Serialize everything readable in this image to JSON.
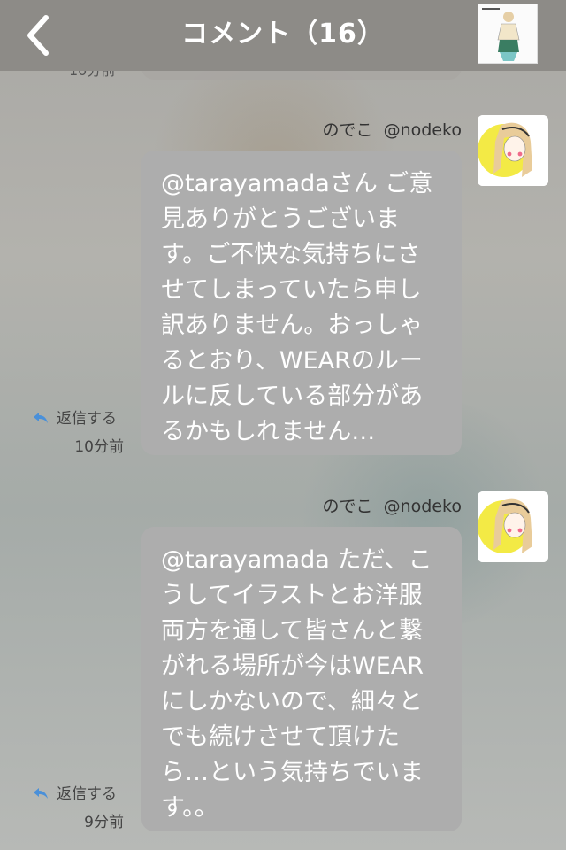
{
  "header": {
    "back_icon": "chevron-left-icon",
    "title": "コメント（16）"
  },
  "previous_comment": {
    "time": "10分前"
  },
  "comments": [
    {
      "name": "のでこ",
      "handle": "@nodeko",
      "text": "@tarayamadaさん ご意見ありがとうございます。ご不快な気持ちにさせてしまっていたら申し訳ありません。おっしゃるとおり、WEARのルールに反している部分があるかもしれません…",
      "reply_label": "返信する",
      "time": "10分前"
    },
    {
      "name": "のでこ",
      "handle": "@nodeko",
      "text": "@tarayamada ただ、こうしてイラストとお洋服両方を通して皆さんと繋がれる場所が今はWEARにしかないので、細々とでも続けさせて頂けたら…という気持ちでいます。。",
      "reply_label": "返信する",
      "time": "9分前"
    }
  ],
  "colors": {
    "header_bg": "#8d8b87",
    "bubble_bg": "#adadad",
    "reply_icon": "#4a90d9"
  }
}
